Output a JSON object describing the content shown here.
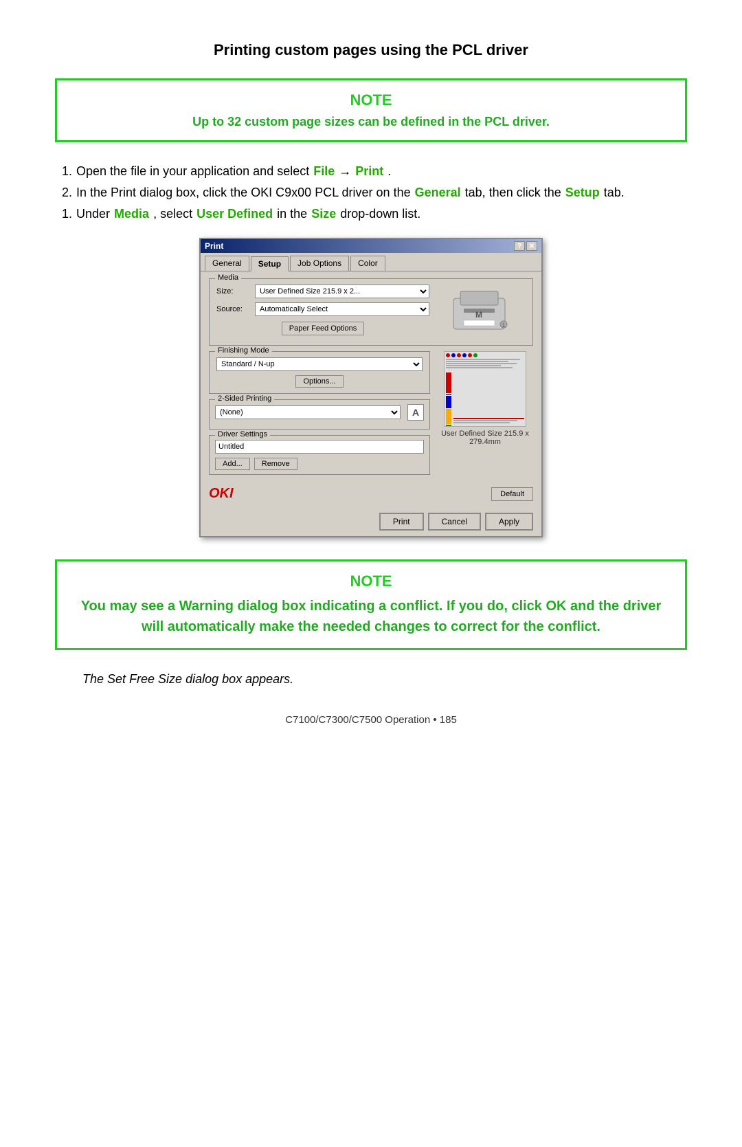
{
  "title": "Printing custom pages using the PCL driver",
  "note1": {
    "heading": "NOTE",
    "text": "Up to 32 custom page sizes can be defined in the PCL driver."
  },
  "steps": [
    {
      "num": "1.",
      "text_before": "Open the file in your application and select ",
      "highlight1": "File",
      "separator": " → ",
      "highlight2": "Print",
      "text_after": "."
    },
    {
      "num": "2.",
      "text_before": "In the Print dialog box, click the OKI C9x00 PCL driver on the ",
      "highlight1": "General",
      "text_mid1": " tab, then click the ",
      "highlight2": "Setup",
      "text_after": " tab."
    },
    {
      "num": "1.",
      "text_before": "Under ",
      "highlight1": "Media",
      "text_mid1": ",  select ",
      "highlight2": "User Defined",
      "text_mid2": " in the ",
      "highlight3": "Size",
      "text_after": " drop-down list."
    }
  ],
  "dialog": {
    "title": "Print",
    "title_hint": "?|X",
    "tabs": [
      "General",
      "Setup",
      "Job Options",
      "Color"
    ],
    "active_tab": "Setup",
    "media_section": {
      "label": "Media",
      "size_label": "Size:",
      "size_value": "User Defined Size 215.9 x 2...",
      "source_label": "Source:",
      "source_value": "Automatically Select",
      "paper_feed_btn": "Paper Feed Options"
    },
    "finishing_section": {
      "label": "Finishing Mode",
      "value": "Standard / N-up",
      "options_btn": "Options..."
    },
    "two_sided_section": {
      "label": "2-Sided Printing",
      "value": "(None)"
    },
    "driver_settings_section": {
      "label": "Driver Settings",
      "value": "Untitled",
      "add_btn": "Add...",
      "remove_btn": "Remove"
    },
    "oki_logo": "OKI",
    "default_btn": "Default",
    "user_defined_text": "User Defined Size 215.9 x 279.4mm",
    "buttons": [
      "Print",
      "Cancel",
      "Apply"
    ]
  },
  "note2": {
    "heading": "NOTE",
    "text": "You  may see a Warning dialog box indicating a conflict. If you do, click OK and the driver will automatically make the needed changes to correct for the conflict."
  },
  "italic_note": "The Set Free Size dialog box appears.",
  "footer": "C7100/C7300/C7500  Operation • 185"
}
